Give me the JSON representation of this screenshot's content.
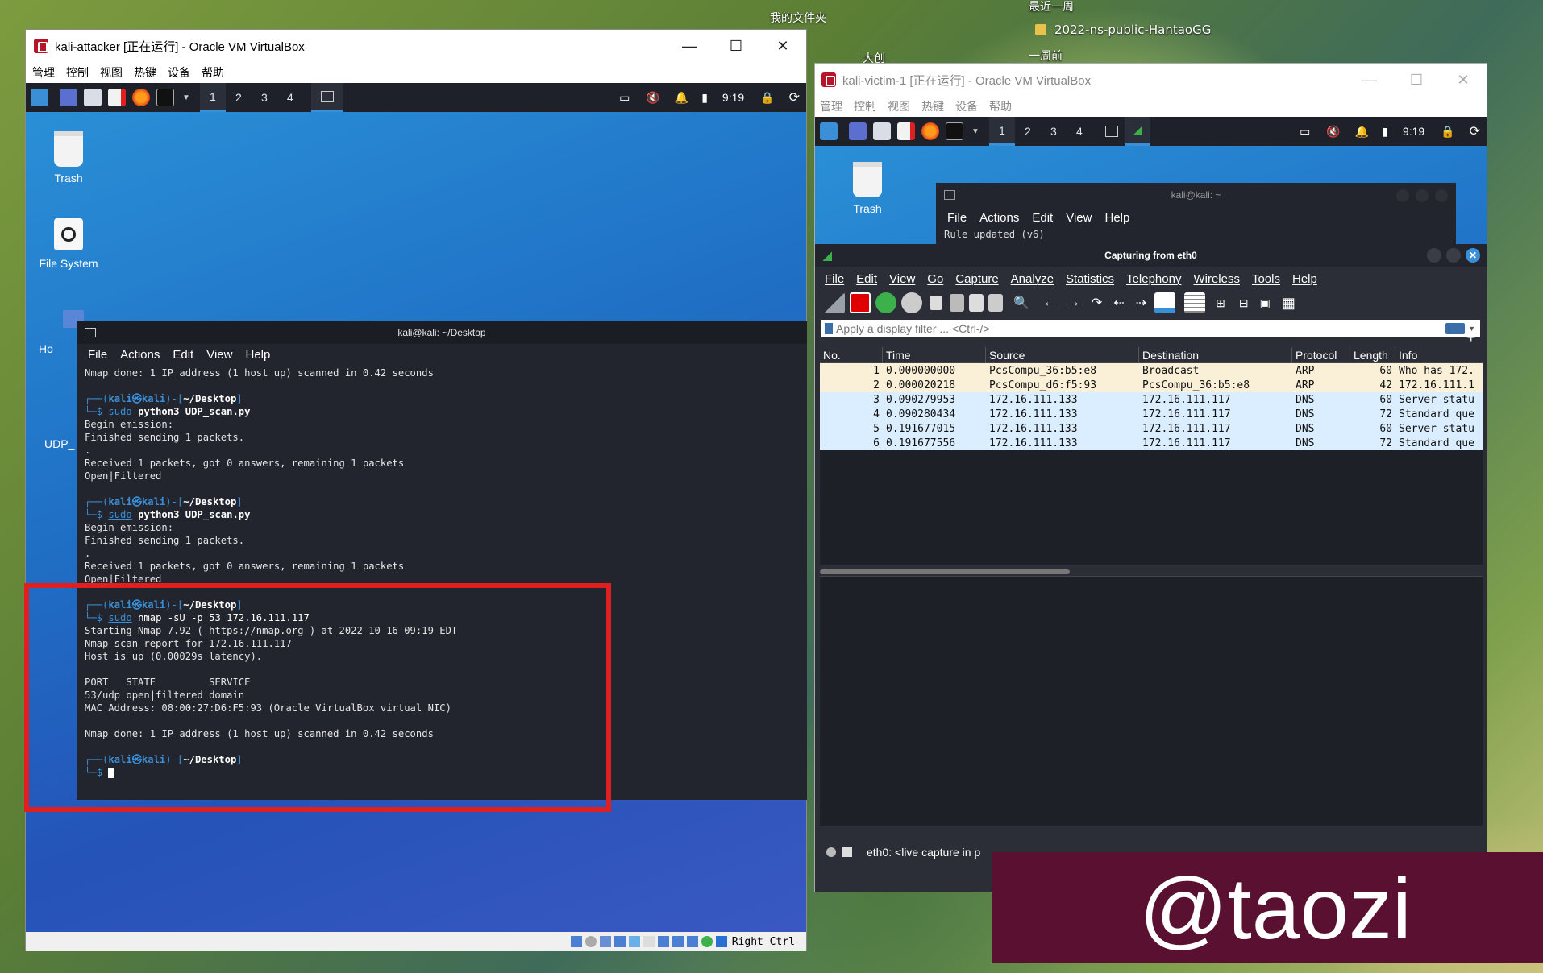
{
  "host": {
    "top_labels": [
      "我的文件夹",
      "最近一周",
      "2022-ns-public-HantaoGG",
      "大创",
      "一周前"
    ],
    "watermark": "@taozi"
  },
  "attacker": {
    "title": "kali-attacker [正在运行] - Oracle VM VirtualBox",
    "menu": [
      "管理",
      "控制",
      "视图",
      "热键",
      "设备",
      "帮助"
    ],
    "workspaces": [
      "1",
      "2",
      "3",
      "4"
    ],
    "clock": "9:19",
    "desktop_icons": [
      "Trash",
      "File System",
      "Ho",
      "UDP_"
    ],
    "statusbar_text": "Right Ctrl",
    "terminal": {
      "title": "kali@kali: ~/Desktop",
      "menu": [
        "File",
        "Actions",
        "Edit",
        "View",
        "Help"
      ],
      "prompt_user": "kali",
      "prompt_host": "kali",
      "prompt_dir": "~/Desktop",
      "sudo": "sudo",
      "lines_top": "Nmap done: 1 IP address (1 host up) scanned in 0.42 seconds",
      "cmd1": "python3 UDP_scan.py",
      "out1": [
        "Begin emission:",
        "Finished sending 1 packets.",
        ".",
        "Received 1 packets, got 0 answers, remaining 1 packets",
        "Open|Filtered"
      ],
      "cmd2": "python3 UDP_scan.py",
      "out2": [
        "Begin emission:",
        "Finished sending 1 packets.",
        ".",
        "Received 1 packets, got 0 answers, remaining 1 packets",
        "Open|Filtered"
      ],
      "cmd3": "nmap -sU -p 53 172.16.111.117",
      "out3": [
        "Starting Nmap 7.92 ( https://nmap.org ) at 2022-10-16 09:19 EDT",
        "Nmap scan report for 172.16.111.117",
        "Host is up (0.00029s latency).",
        "",
        "PORT   STATE         SERVICE",
        "53/udp open|filtered domain",
        "MAC Address: 08:00:27:D6:F5:93 (Oracle VirtualBox virtual NIC)",
        "",
        "Nmap done: 1 IP address (1 host up) scanned in 0.42 seconds"
      ]
    }
  },
  "victim": {
    "title": "kali-victim-1 [正在运行] - Oracle VM VirtualBox",
    "menu": [
      "管理",
      "控制",
      "视图",
      "热键",
      "设备",
      "帮助"
    ],
    "workspaces": [
      "1",
      "2",
      "3",
      "4"
    ],
    "clock": "9:19",
    "desktop_icons": [
      "Trash"
    ],
    "bg_terminal": {
      "title": "kali@kali: ~",
      "menu": [
        "File",
        "Actions",
        "Edit",
        "View",
        "Help"
      ],
      "line": "Rule updated (v6)"
    },
    "wireshark": {
      "title": "Capturing from eth0",
      "menu": [
        "File",
        "Edit",
        "View",
        "Go",
        "Capture",
        "Analyze",
        "Statistics",
        "Telephony",
        "Wireless",
        "Tools",
        "Help"
      ],
      "filter_placeholder": "Apply a display filter ... <Ctrl-/>",
      "columns": [
        "No.",
        "Time",
        "Source",
        "Destination",
        "Protocol",
        "Length",
        "Info"
      ],
      "packets": [
        {
          "no": "1",
          "time": "0.000000000",
          "src": "PcsCompu_36:b5:e8",
          "dst": "Broadcast",
          "proto": "ARP",
          "len": "60",
          "info": "Who has 172.",
          "bg": "#faf0d7"
        },
        {
          "no": "2",
          "time": "0.000020218",
          "src": "PcsCompu_d6:f5:93",
          "dst": "PcsCompu_36:b5:e8",
          "proto": "ARP",
          "len": "42",
          "info": "172.16.111.1",
          "bg": "#faf0d7"
        },
        {
          "no": "3",
          "time": "0.090279953",
          "src": "172.16.111.133",
          "dst": "172.16.111.117",
          "proto": "DNS",
          "len": "60",
          "info": "Server statu",
          "bg": "#daeeff"
        },
        {
          "no": "4",
          "time": "0.090280434",
          "src": "172.16.111.133",
          "dst": "172.16.111.117",
          "proto": "DNS",
          "len": "72",
          "info": "Standard que",
          "bg": "#daeeff"
        },
        {
          "no": "5",
          "time": "0.191677015",
          "src": "172.16.111.133",
          "dst": "172.16.111.117",
          "proto": "DNS",
          "len": "60",
          "info": "Server statu",
          "bg": "#daeeff"
        },
        {
          "no": "6",
          "time": "0.191677556",
          "src": "172.16.111.133",
          "dst": "172.16.111.117",
          "proto": "DNS",
          "len": "72",
          "info": "Standard que",
          "bg": "#daeeff"
        }
      ],
      "status_text": "eth0: <live capture in p"
    }
  },
  "colors": {
    "highlight_box": "#e02020",
    "kali_blue": "#3b8fd6",
    "panel_bg": "#1e2129",
    "watermark_bg": "#5a1030"
  }
}
